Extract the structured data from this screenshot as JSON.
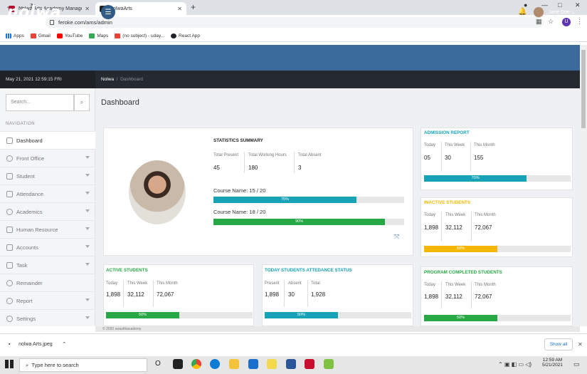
{
  "browser": {
    "tabs": [
      {
        "title": "Nolwa Arts Academy Manageme",
        "active": false
      },
      {
        "title": "NolwaArts",
        "active": true
      }
    ],
    "url": "feroke.com/ams/admin",
    "profile_initial": "U",
    "bookmarks": [
      "Apps",
      "Gmail",
      "YouTube",
      "Maps",
      "(no subject) - uday...",
      "React App"
    ]
  },
  "app": {
    "logo": "nolwa",
    "user_name": "Jane Doe",
    "datetime": "May 21, 2021 12:59:15 FRI",
    "breadcrumb": {
      "root": "Nolwa",
      "current": "Dashboard"
    },
    "search_placeholder": "Search...",
    "nav_heading": "NAVIGATION",
    "nav_items": [
      "Dashboard",
      "Front Office",
      "Student",
      "Attendance",
      "Academics",
      "Human Resource",
      "Accounts",
      "Task",
      "Remainder",
      "Report",
      "Settings"
    ],
    "page_title": "Dashboard",
    "footer": "© 2020 swasthiacademy"
  },
  "stats": {
    "title": "STATISTICS SUMMARY",
    "labels": [
      "Total Present",
      "Total Working Hours",
      "Total Absent"
    ],
    "values": [
      "45",
      "180",
      "3"
    ],
    "courses": [
      {
        "label": "Course Name: 15 / 20",
        "pct": 0.75,
        "text": "75%",
        "color": "#17a2b8"
      },
      {
        "label": "Course Name: 18 / 20",
        "pct": 0.9,
        "text": "90%",
        "color": "#28a745"
      }
    ]
  },
  "cards": {
    "admission": {
      "title": "ADMISSION REPORT",
      "color": "#17a2b8",
      "labels": [
        "Today",
        "This Week",
        "This Month"
      ],
      "values": [
        "05",
        "30",
        "155"
      ],
      "pct": 0.7,
      "text": "70%"
    },
    "inactive": {
      "title": "INACTIVE STUDENTS",
      "color": "#f5b800",
      "labels": [
        "Today",
        "This Week",
        "This Month"
      ],
      "values": [
        "1,898",
        "32,112",
        "72,067"
      ],
      "pct": 0.5,
      "text": "50%"
    },
    "active": {
      "title": "ACTIVE STUDENTS",
      "color": "#28a745",
      "labels": [
        "Today",
        "This Week",
        "This Month"
      ],
      "values": [
        "1,898",
        "32,112",
        "72,067"
      ],
      "pct": 0.5,
      "text": "50%"
    },
    "attendance": {
      "title": "TODAY STUDENTS ATTEDANCE STATUS",
      "color": "#17a2b8",
      "labels": [
        "Present",
        "Absent",
        "Total"
      ],
      "values": [
        "1,898",
        "30",
        "1,928"
      ],
      "pct": 0.5,
      "text": "50%"
    },
    "completed": {
      "title": "PROGRAM COMPLETED STUDENTS",
      "color": "#28a745",
      "labels": [
        "Today",
        "This Week",
        "This Month"
      ],
      "values": [
        "1,898",
        "32,112",
        "72,067"
      ],
      "pct": 0.5,
      "text": "50%"
    }
  },
  "downloads": {
    "file": "nolwa Arts.jpeg",
    "show_all": "Show all"
  },
  "taskbar": {
    "search": "Type here to search",
    "time": "12:59 AM",
    "date": "5/21/2021"
  }
}
